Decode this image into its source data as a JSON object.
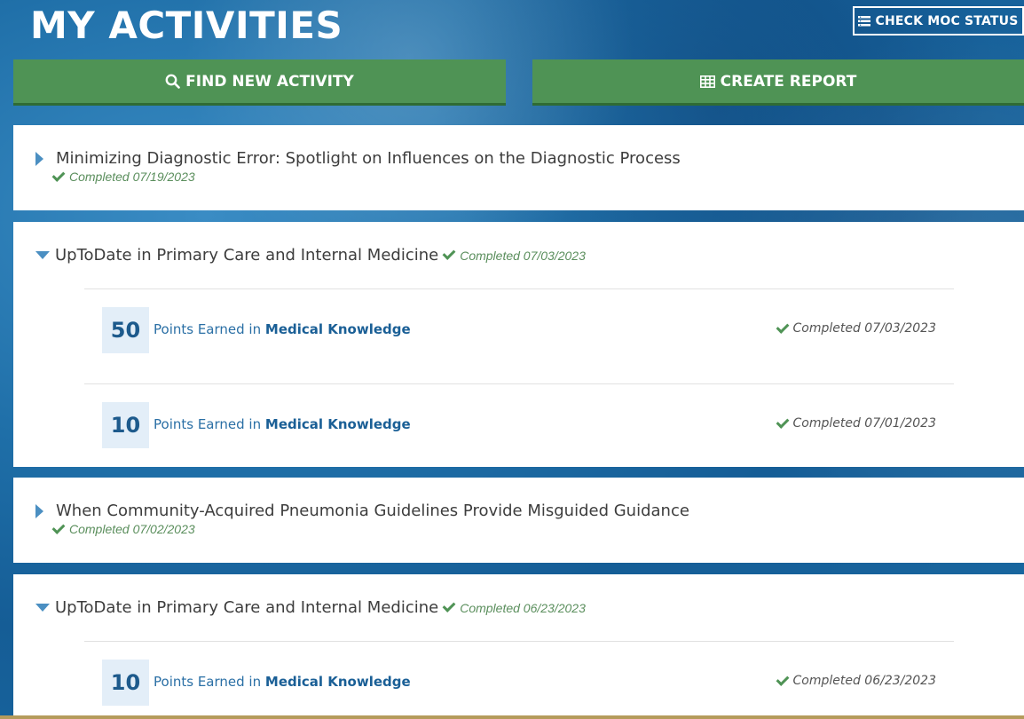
{
  "header": {
    "title": "MY ACTIVITIES",
    "check_moc_label": "CHECK MOC STATUS"
  },
  "actions": {
    "find_label": "FIND NEW ACTIVITY",
    "report_label": "CREATE REPORT"
  },
  "activities": [
    {
      "title": "Minimizing Diagnostic Error: Spotlight on Influences on the Diagnostic Process",
      "status": "Completed 07/19/2023",
      "expanded": false
    },
    {
      "title": "UpToDate in Primary Care and Internal Medicine",
      "status": "Completed 07/03/2023",
      "expanded": true,
      "points": [
        {
          "value": "50",
          "label": "Points Earned in",
          "domain": "Medical Knowledge",
          "status": "Completed 07/03/2023"
        },
        {
          "value": "10",
          "label": "Points Earned in",
          "domain": "Medical Knowledge",
          "status": "Completed 07/01/2023"
        }
      ]
    },
    {
      "title": "When Community-Acquired Pneumonia Guidelines Provide Misguided Guidance",
      "status": "Completed 07/02/2023",
      "expanded": false
    },
    {
      "title": "UpToDate in Primary Care and Internal Medicine",
      "status": "Completed 06/23/2023",
      "expanded": true,
      "points": [
        {
          "value": "10",
          "label": "Points Earned in",
          "domain": "Medical Knowledge",
          "status": "Completed 06/23/2023"
        }
      ]
    }
  ],
  "icons": {
    "search": "search-icon",
    "table": "table-icon",
    "list": "list-icon",
    "check": "check-icon",
    "caret_right": "caret-right-icon",
    "caret_down": "caret-down-icon"
  },
  "colors": {
    "accent_green": "#4f9355",
    "accent_blue": "#1d5a8c",
    "completed_green": "#5a8e5c"
  }
}
